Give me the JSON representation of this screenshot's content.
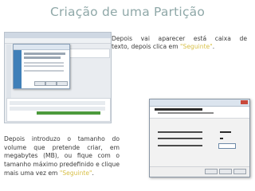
{
  "slide": {
    "title": "Criação de uma Partição",
    "paragraph_top_line1": "Depois vai aparecer está caixa de",
    "paragraph_top_line2_prefix": "texto, depois clica em ",
    "paragraph_top_highlight": "\"Seguinte\"",
    "paragraph_top_suffix": ".",
    "paragraph_bottom_prefix": "Depois introduzo o tamanho do volume que pretende criar, em megabytes (MB), ou fique com o tamanho máximo predefinido e clique mais uma vez em ",
    "paragraph_bottom_highlight": "\"Seguinte\"",
    "paragraph_bottom_suffix": ".",
    "highlight_color": "#d8c14a",
    "title_color": "#8fa8a8"
  },
  "screenshot_wizard": {
    "dialog_title": "Bem-vindo ao Assistente de Novo Volume Simples"
  },
  "screenshot_size": {
    "window_title": "Assistente de Novo Volume Simples",
    "heading": "Especificar o tamanho do volume",
    "fields": [
      {
        "label": "Espaço máximo em disco em MB:",
        "value": "31767"
      },
      {
        "label": "Espaço mínimo em disco em MB:",
        "value": "8"
      },
      {
        "label": "Tamanho do volume simples em MB:",
        "value": "1000"
      }
    ]
  }
}
